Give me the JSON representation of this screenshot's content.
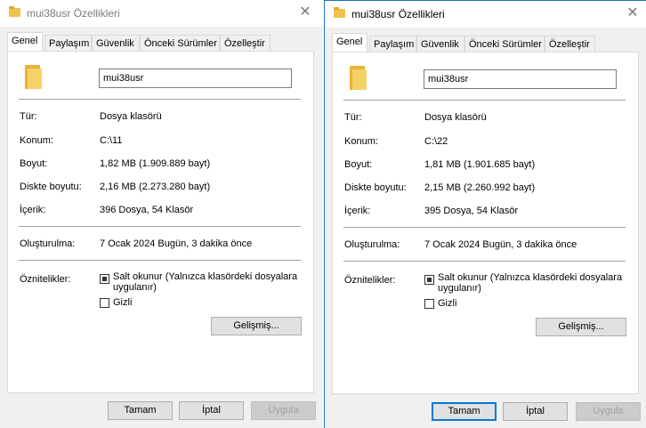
{
  "tabs": [
    "Genel",
    "Paylaşım",
    "Güvenlik",
    "Önceki Sürümler",
    "Özelleştir"
  ],
  "labels": {
    "type": "Tür:",
    "location": "Konum:",
    "size": "Boyut:",
    "size_on_disk": "Diskte boyutu:",
    "contains": "İçerik:",
    "created": "Oluşturulma:",
    "attributes": "Öznitelikler:",
    "readonly": "Salt okunur (Yalnızca klasördeki dosyalara uygulanır)",
    "hidden": "Gizli",
    "advanced": "Gelişmiş...",
    "ok": "Tamam",
    "cancel": "İptal",
    "apply": "Uygula"
  },
  "left": {
    "title": "mui38usr Özellikleri",
    "name": "mui38usr",
    "type": "Dosya klasörü",
    "location": "C:\\11",
    "size": "1,82 MB (1.909.889 bayt)",
    "size_on_disk": "2,16 MB (2.273.280 bayt)",
    "contains": "396 Dosya, 54 Klasör",
    "created": "7 Ocak 2024 Bugün, 3 dakika önce"
  },
  "right": {
    "title": "mui38usr Özellikleri",
    "name": "mui38usr",
    "type": "Dosya klasörü",
    "location": "C:\\22",
    "size": "1,81 MB (1.901.685 bayt)",
    "size_on_disk": "2,15 MB (2.260.992 bayt)",
    "contains": "395 Dosya, 54 Klasör",
    "created": "7 Ocak 2024 Bugün, 3 dakika önce"
  },
  "icons": {
    "title": "folder-icon",
    "close": "close-icon",
    "folder": "folder-icon"
  }
}
